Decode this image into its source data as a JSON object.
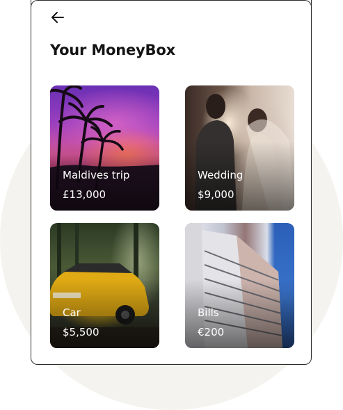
{
  "header": {
    "back_icon": "arrow-left-icon",
    "title": "Your MoneyBox"
  },
  "moneyboxes": [
    {
      "name": "Maldives trip",
      "amount": "£13,000",
      "image": "tropical-sunset-palms"
    },
    {
      "name": "Wedding",
      "amount": "$9,000",
      "image": "wedding-couple"
    },
    {
      "name": "Car",
      "amount": "$5,500",
      "image": "yellow-suv-forest"
    },
    {
      "name": "Bills",
      "amount": "€200",
      "image": "apartment-tower"
    }
  ],
  "colors": {
    "background_circle": "#f4f3ef",
    "text_dark": "#141414",
    "card_border": "#2b2b2b"
  }
}
